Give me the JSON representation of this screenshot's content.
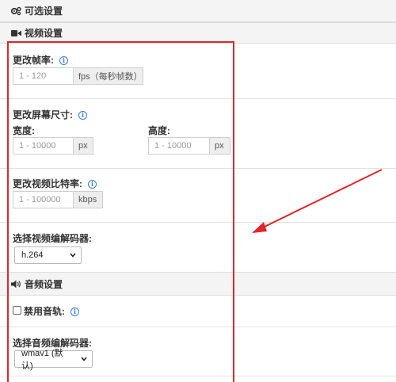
{
  "header": {
    "title": "可选设置",
    "icon": "gears-icon"
  },
  "video_section": {
    "title": "视频设置",
    "icon": "video-camera-icon"
  },
  "frame_rate": {
    "label": "更改帧率:",
    "placeholder": "1 - 120",
    "unit": "fps（每秒帧数）"
  },
  "resolution": {
    "label": "更改屏幕尺寸:",
    "width_label": "宽度:",
    "width_placeholder": "1 - 10000",
    "width_unit": "px",
    "height_label": "高度:",
    "height_placeholder": "1 - 10000",
    "height_unit": "px"
  },
  "bitrate": {
    "label": "更改视频比特率:",
    "placeholder": "1 - 100000",
    "unit": "kbps"
  },
  "video_codec": {
    "label": "选择视频编解码器:",
    "selected": "h.264"
  },
  "audio_section": {
    "title": "音频设置",
    "icon": "speaker-icon"
  },
  "disable_audio": {
    "label": "禁用音轨:"
  },
  "audio_codec": {
    "label": "选择音频编解码器:",
    "selected": "wmav1 (默认)"
  },
  "colors": {
    "highlight": "#e0262a",
    "info": "#3c7bd6",
    "band": "#f4f4f4"
  }
}
